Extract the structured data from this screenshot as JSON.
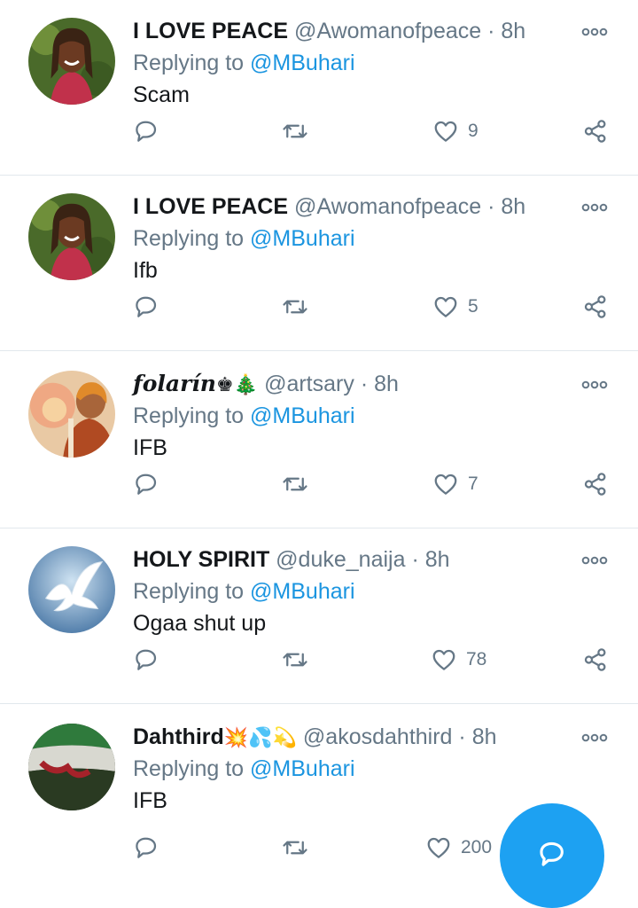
{
  "tweets": [
    {
      "name": "I LOVE PEACE",
      "badges": "",
      "handle": "@Awomanofpeace",
      "dot": "·",
      "time": "8h",
      "replying_prefix": "Replying to",
      "mention": "@MBuhari",
      "text": "Scam",
      "likes": "9",
      "avatar": "woman-portrait"
    },
    {
      "name": "I LOVE PEACE",
      "badges": "",
      "handle": "@Awomanofpeace",
      "dot": "·",
      "time": "8h",
      "replying_prefix": "Replying to",
      "mention": "@MBuhari",
      "text": "Ifb",
      "likes": "5",
      "avatar": "woman-portrait"
    },
    {
      "name": "folarín",
      "badges": "♚🎄",
      "handle": "@artsary",
      "dot": "·",
      "time": "8h",
      "replying_prefix": "Replying to",
      "mention": "@MBuhari",
      "text": "IFB",
      "likes": "7",
      "avatar": "person-flower"
    },
    {
      "name": "HOLY SPIRIT",
      "badges": "",
      "handle": "@duke_naija",
      "dot": "·",
      "time": "8h",
      "replying_prefix": "Replying to",
      "mention": "@MBuhari",
      "text": "Ogaa shut up",
      "likes": "78",
      "avatar": "white-dove"
    },
    {
      "name": "Dahthird",
      "badges": "💥💦💫",
      "handle": "@akosdahthird",
      "dot": "·",
      "time": "8h",
      "replying_prefix": "Replying to",
      "mention": "@MBuhari",
      "text": "IFB",
      "likes": "200",
      "avatar": "green-white-flag"
    }
  ],
  "icons": {
    "reply": "reply-icon",
    "retweet": "retweet-icon",
    "like": "heart-icon",
    "share": "share-icon",
    "more": "more-options-icon",
    "compose": "compose-icon"
  },
  "colors": {
    "accent": "#1da1f2",
    "mention": "#1b95e0",
    "muted": "#657786",
    "divider": "#e1e8ed"
  }
}
